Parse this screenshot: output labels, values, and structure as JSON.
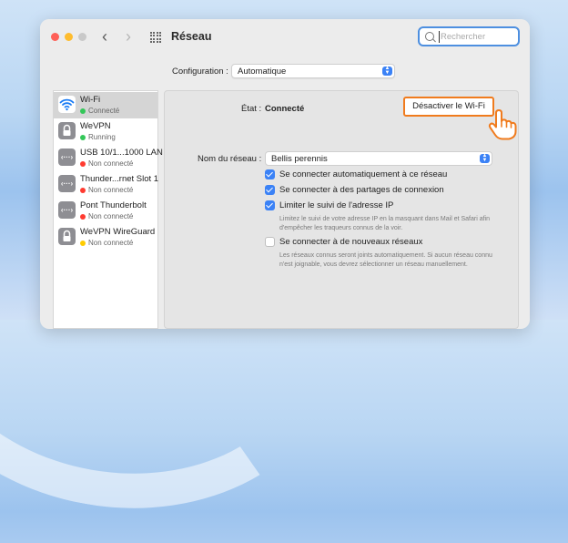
{
  "window": {
    "title": "Réseau"
  },
  "search": {
    "placeholder": "Rechercher"
  },
  "configuration": {
    "label": "Configuration :",
    "value": "Automatique"
  },
  "sidebar": {
    "items": [
      {
        "name": "Wi-Fi",
        "status": "Connecté",
        "status_color": "#34c759",
        "icon": "wifi-icon",
        "selected": true
      },
      {
        "name": "WeVPN",
        "status": "Running",
        "status_color": "#34c759",
        "icon": "lock-icon"
      },
      {
        "name": "USB 10/1...1000 LAN",
        "status": "Non connecté",
        "status_color": "#ff3b30",
        "icon": "ethernet-icon"
      },
      {
        "name": "Thunder...rnet Slot 1",
        "status": "Non connecté",
        "status_color": "#ff3b30",
        "icon": "ethernet-icon"
      },
      {
        "name": "Pont Thunderbolt",
        "status": "Non connecté",
        "status_color": "#ff3b30",
        "icon": "ethernet-icon"
      },
      {
        "name": "WeVPN WireGuard",
        "status": "Non connecté",
        "status_color": "#ffcc00",
        "icon": "lock-icon"
      }
    ]
  },
  "detail": {
    "state_label": "État :",
    "state_value": "Connecté",
    "deactivate_button": "Désactiver le Wi-Fi",
    "network_name_label": "Nom du réseau :",
    "network_name_value": "Bellis perennis",
    "options": [
      {
        "label": "Se connecter automatiquement à ce réseau",
        "checked": true
      },
      {
        "label": "Se connecter à des partages de connexion",
        "checked": true
      },
      {
        "label": "Limiter le suivi de l'adresse IP",
        "checked": true,
        "help": "Limitez le suivi de votre adresse IP en la masquant dans Mail et Safari afin d'empêcher les traqueurs connus de la voir."
      },
      {
        "label": "Se connecter à de nouveaux réseaux",
        "checked": false,
        "help": "Les réseaux connus seront joints automatiquement. Si aucun réseau connu n'est joignable, vous devrez sélectionner un réseau manuellement."
      }
    ]
  },
  "colors": {
    "accent": "#3b82f6",
    "highlight": "#f07b1d"
  }
}
